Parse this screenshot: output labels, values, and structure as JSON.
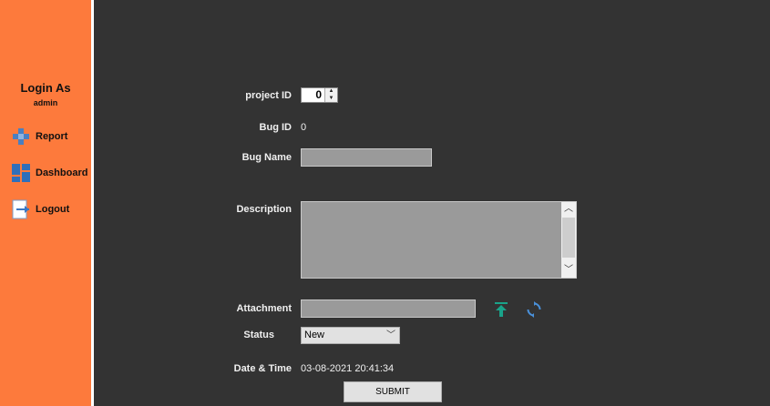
{
  "sidebar": {
    "login_title": "Login  As",
    "login_user": "admin",
    "items": [
      {
        "label": "Report",
        "icon": "plus-icon"
      },
      {
        "label": "Dashboard",
        "icon": "dashboard-icon"
      },
      {
        "label": "Logout",
        "icon": "logout-icon"
      }
    ]
  },
  "form": {
    "project_id_label": "project ID",
    "project_id_value": "0",
    "bug_id_label": "Bug ID",
    "bug_id_value": "0",
    "bug_name_label": "Bug Name",
    "bug_name_value": "",
    "description_label": "Description",
    "description_value": "",
    "attachment_label": "Attachment",
    "attachment_value": "",
    "status_label": "Status",
    "status_value": "New",
    "datetime_label": "Date & Time",
    "datetime_value": "03-08-2021 20:41:34",
    "submit_label": "SUBMIT"
  },
  "colors": {
    "sidebar": "#fd7a3c",
    "background": "#333333",
    "upload_icon": "#1aa38a",
    "refresh_icon": "#4a90d9"
  }
}
